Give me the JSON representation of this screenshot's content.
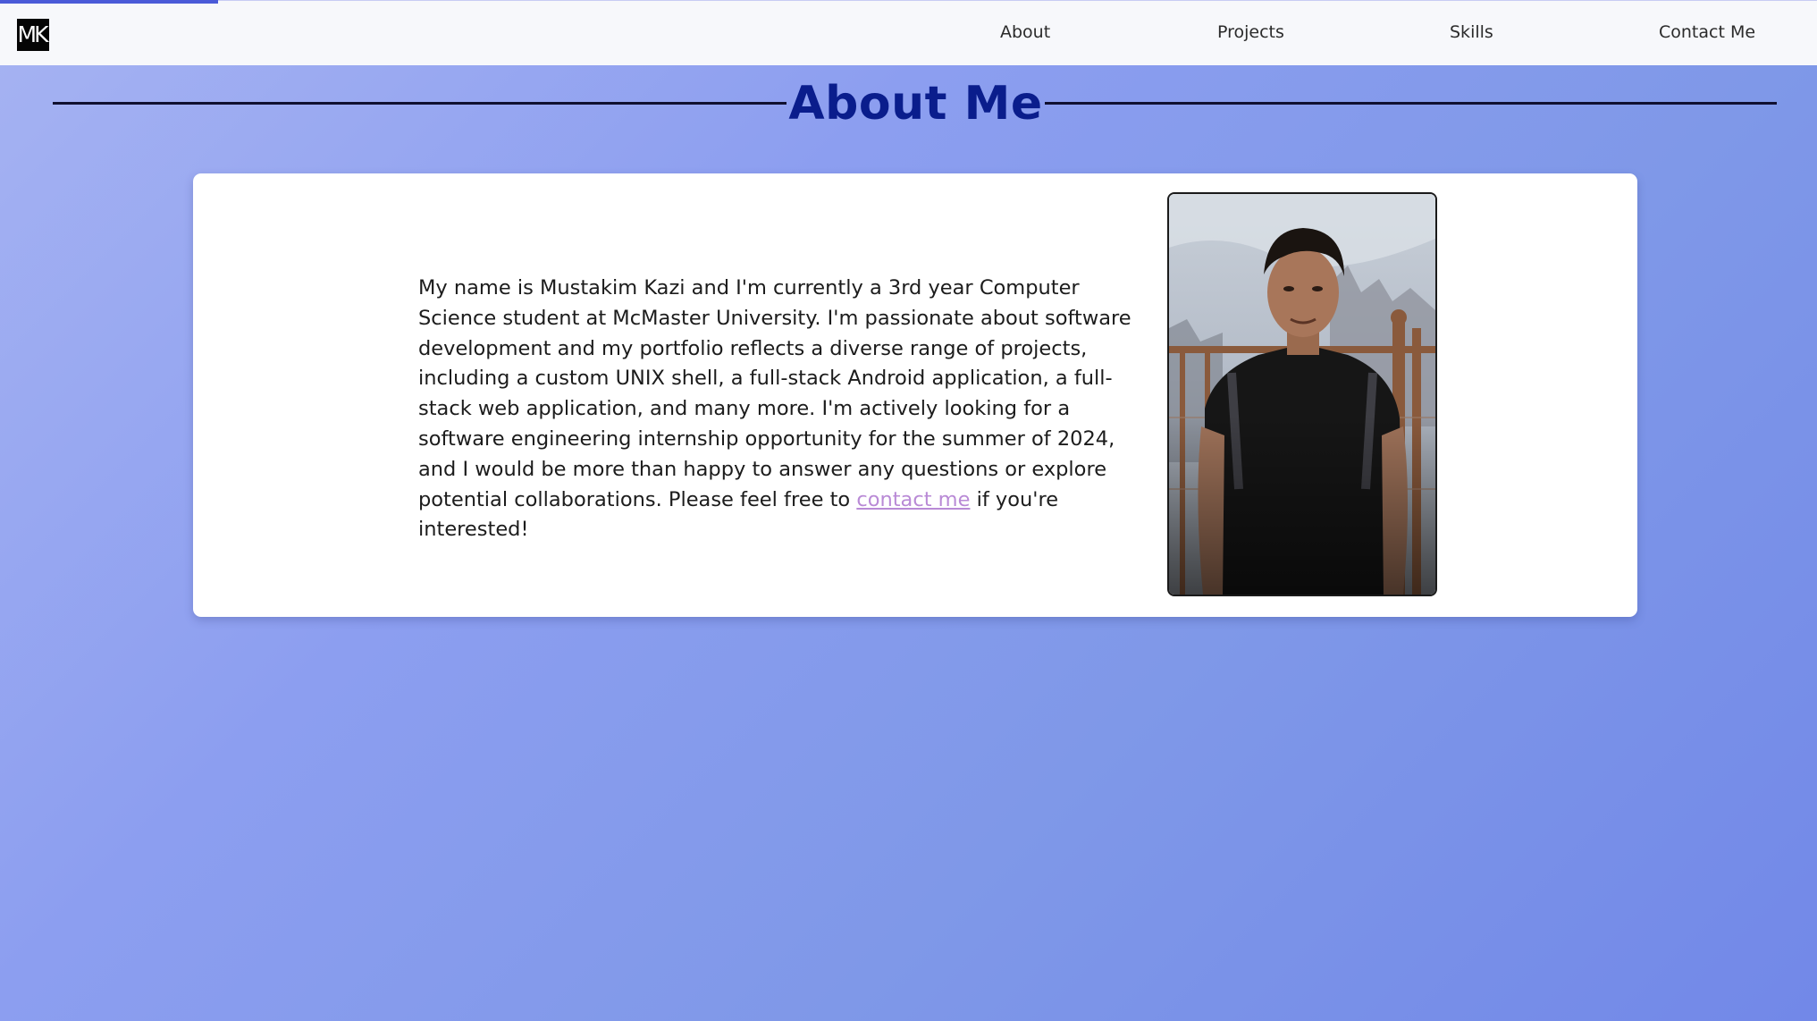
{
  "scroll_progress_percent": 12,
  "nav": {
    "logo_text": "MK",
    "links": [
      "About",
      "Projects",
      "Skills",
      "Contact Me"
    ]
  },
  "about": {
    "title": "About Me",
    "bio_text": "My name is Mustakim Kazi and I'm currently a 3rd year Computer Science student at McMaster University. I'm passionate about software development and my portfolio reflects a diverse range of projects, including a custom UNIX shell, a full-stack Android application, a full-stack web application, and many more. I'm actively looking for a software engineering internship opportunity for the summer of 2024, and I would be more than happy to answer any questions or explore potential collaborations. Please feel free to",
    "contact_link": "contact me",
    "bio_suffix": "if you're interested!"
  },
  "colors": {
    "accent": "#0a1d8c",
    "link": "#b98ad6",
    "progress": "#4a5ad8"
  }
}
